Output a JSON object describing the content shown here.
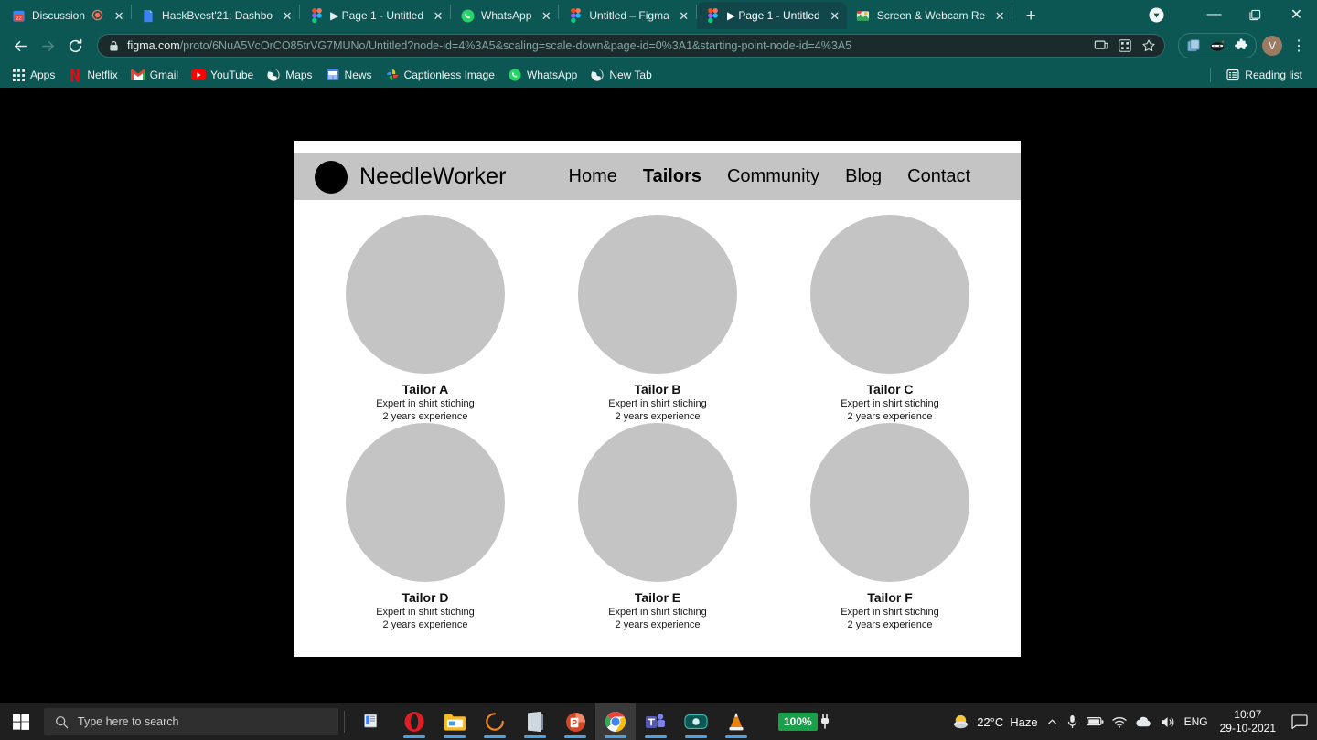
{
  "browser": {
    "tabs": [
      {
        "title": "Discussion",
        "favicon": "calendar-icon",
        "audio_playing": true,
        "active": false
      },
      {
        "title": "HackBvest'21: Dashbo",
        "favicon": "document-icon",
        "audio_playing": false,
        "active": false
      },
      {
        "title": "▶ Page 1 - Untitled",
        "favicon": "figma-icon",
        "audio_playing": false,
        "active": false
      },
      {
        "title": "WhatsApp",
        "favicon": "whatsapp-icon",
        "audio_playing": false,
        "active": false
      },
      {
        "title": "Untitled – Figma",
        "favicon": "figma-icon",
        "audio_playing": false,
        "active": false
      },
      {
        "title": "▶ Page 1 - Untitled",
        "favicon": "figma-icon",
        "audio_playing": false,
        "active": true
      },
      {
        "title": "Screen & Webcam Re",
        "favicon": "screen-recorder-icon",
        "audio_playing": false,
        "active": false
      }
    ],
    "new_tab_label": "+",
    "window_controls": {
      "minimize": "—",
      "maximize": "❐",
      "close": "✕"
    },
    "toolbar": {
      "back": "←",
      "forward": "→",
      "reload": "↻",
      "url_domain": "figma.com",
      "url_path": "/proto/6NuA5VcOrCO85trVG7MUNo/Untitled?node-id=4%3A5&scaling=scale-down&page-id=0%3A1&starting-point-node-id=4%3A5",
      "profile_initial": "V",
      "menu": "⋮"
    },
    "bookmarks": [
      {
        "label": "Apps",
        "icon": "apps-grid-icon"
      },
      {
        "label": "Netflix",
        "icon": "netflix-icon"
      },
      {
        "label": "Gmail",
        "icon": "gmail-icon"
      },
      {
        "label": "YouTube",
        "icon": "youtube-icon"
      },
      {
        "label": "Maps",
        "icon": "maps-icon"
      },
      {
        "label": "News",
        "icon": "news-icon"
      },
      {
        "label": "Captionless Image",
        "icon": "photos-icon"
      },
      {
        "label": "WhatsApp",
        "icon": "whatsapp-icon"
      },
      {
        "label": "New Tab",
        "icon": "globe-icon"
      }
    ],
    "reading_list": "Reading list"
  },
  "site": {
    "brand": "NeedleWorker",
    "nav": [
      {
        "label": "Home",
        "active": false
      },
      {
        "label": "Tailors",
        "active": true
      },
      {
        "label": "Community",
        "active": false
      },
      {
        "label": "Blog",
        "active": false
      },
      {
        "label": "Contact",
        "active": false
      }
    ],
    "tailors": [
      {
        "name": "Tailor A",
        "specialty": "Expert in shirt stiching",
        "experience": "2 years experience"
      },
      {
        "name": "Tailor B",
        "specialty": "Expert in shirt stiching",
        "experience": "2 years experience"
      },
      {
        "name": "Tailor C",
        "specialty": "Expert in shirt stiching",
        "experience": "2 years experience"
      },
      {
        "name": "Tailor D",
        "specialty": "Expert in shirt stiching",
        "experience": "2 years experience"
      },
      {
        "name": "Tailor E",
        "specialty": "Expert in shirt stiching",
        "experience": "2 years experience"
      },
      {
        "name": "Tailor F",
        "specialty": "Expert in shirt stiching",
        "experience": "2 years experience"
      }
    ]
  },
  "taskbar": {
    "search_placeholder": "Type here to search",
    "apps": [
      {
        "name": "task-view",
        "active": false,
        "running": false
      },
      {
        "name": "opera",
        "active": false,
        "running": true
      },
      {
        "name": "file-explorer",
        "active": false,
        "running": true
      },
      {
        "name": "loading-app",
        "active": false,
        "running": true
      },
      {
        "name": "onenote",
        "active": false,
        "running": true
      },
      {
        "name": "powerpoint",
        "active": false,
        "running": true
      },
      {
        "name": "chrome",
        "active": true,
        "running": true
      },
      {
        "name": "microsoft-teams",
        "active": false,
        "running": true
      },
      {
        "name": "webcam-recorder",
        "active": false,
        "running": true
      },
      {
        "name": "vlc-media-player",
        "active": false,
        "running": true
      }
    ],
    "battery_level": "100%",
    "weather_temp": "22°C",
    "weather_condition": "Haze",
    "language": "ENG",
    "time": "10:07",
    "date": "29-10-2021"
  },
  "colors": {
    "browser_chrome": "#0c5753",
    "active_tab": "#11474b",
    "placeholder_gray": "#c4c4c4",
    "taskbar": "#1f1f1f",
    "battery_green": "#18a04a"
  }
}
